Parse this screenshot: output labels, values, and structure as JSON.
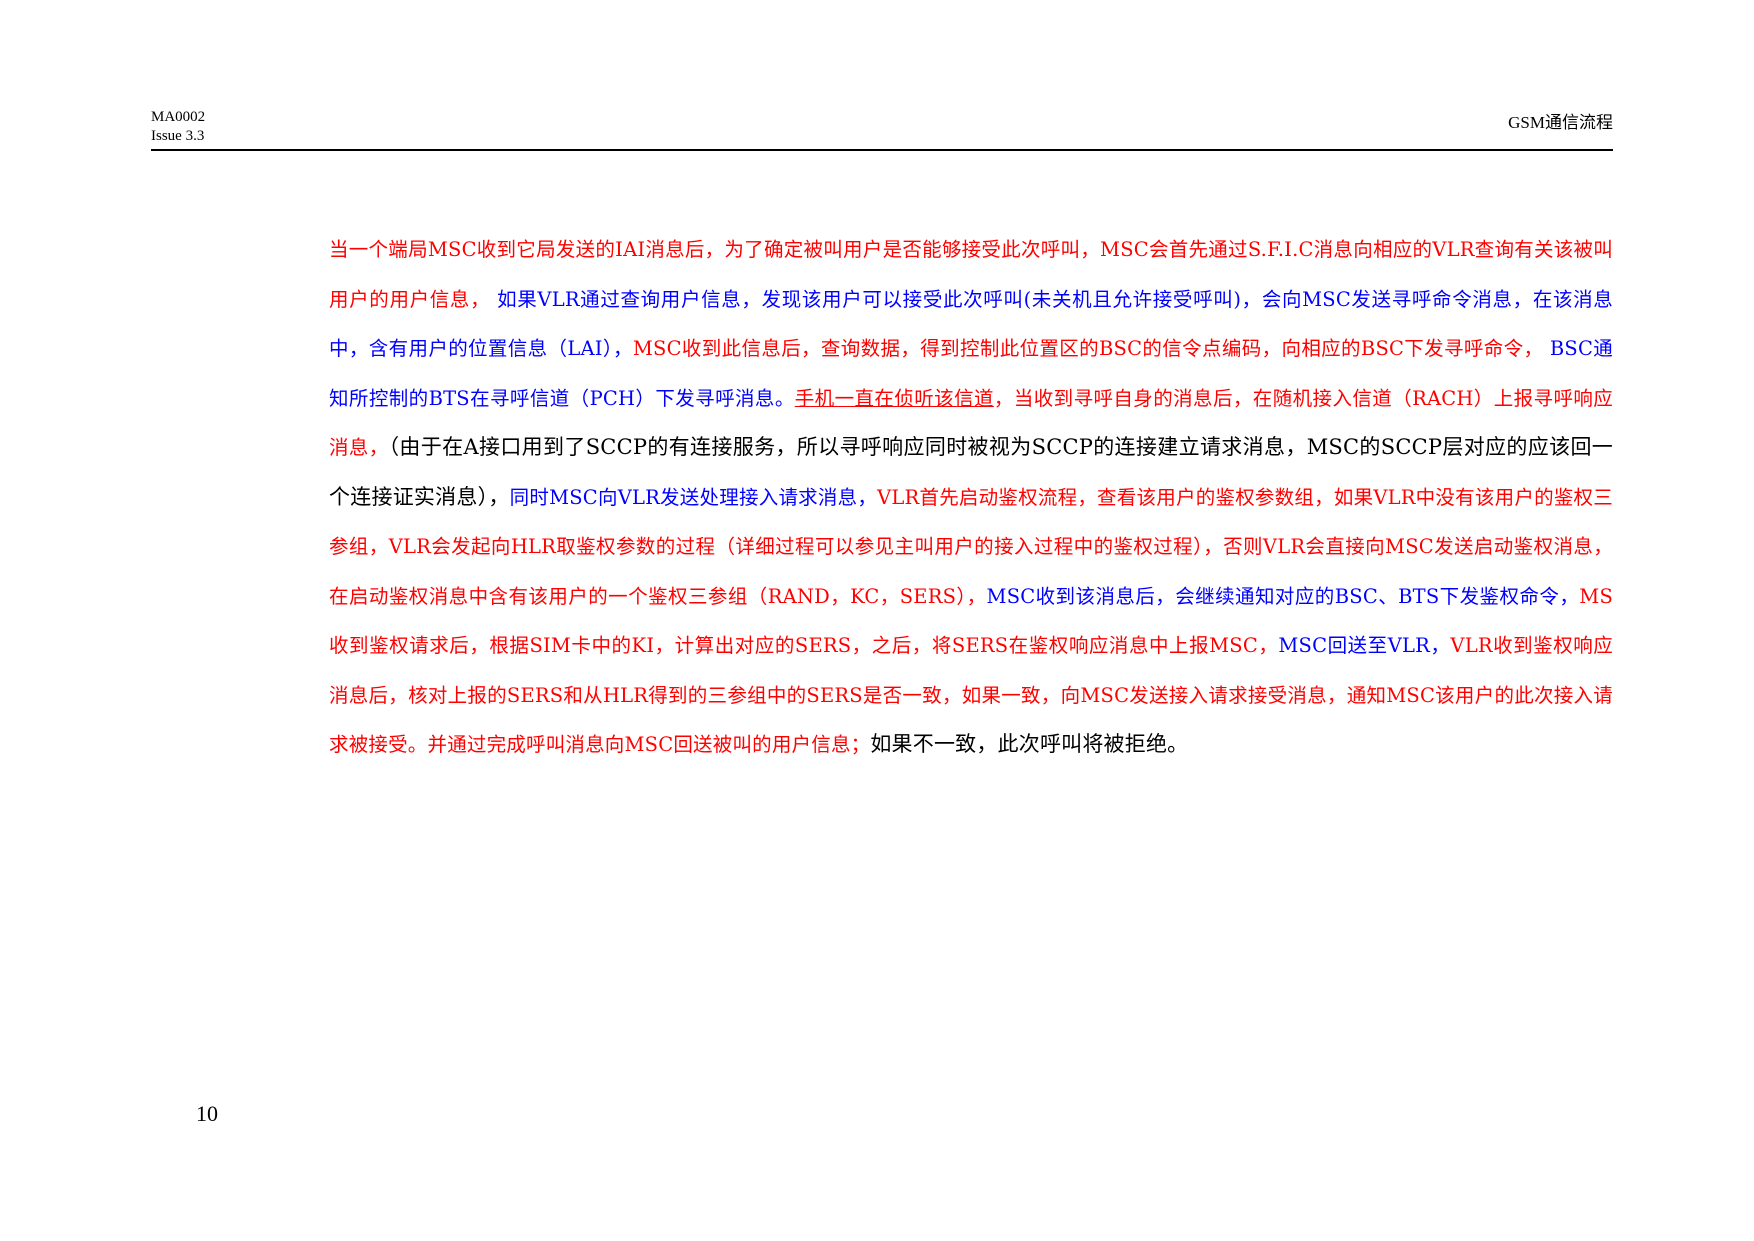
{
  "header": {
    "doc_id": "MA0002",
    "issue": "Issue 3.3",
    "title": "GSM通信流程"
  },
  "colors": {
    "red": "#ff0000",
    "blue": "#0000ff",
    "black": "#000000"
  },
  "paragraph": {
    "s1": "当一个端局MSC收到它局发送的IAI消息后，为了确定被叫用户是否能够接受此次呼叫，MSC会首先通过S.F.I.C消息向相应的VLR查询有关该被叫用户的用户信息，",
    "s2": " 如果VLR通过查询用户信息，发现该用户可以接受此次呼叫(未关机且允许接受呼叫)，会向MSC发送寻呼命令消息，在该消息中，含有用户的位置信息（LAI），",
    "s3": "MSC收到此信息后，查询数据，得到控制此位置区的BSC的信令点编码，向相应的BSC下发寻呼命令，",
    "s4": "  BSC通知所控制的BTS在寻呼信道（PCH）下发寻呼消息。",
    "s5": "手机一直在侦听该信道",
    "s6": "，当收到寻呼自身的消息后，在随机接入信道（RACH）上报寻呼响应消息，",
    "s7": "（由于在A接口用到了SCCP的有连接服务，所以寻呼响应同时被视为SCCP的连接建立请求消息，MSC的SCCP层对应的应该回一个连接证实消息），",
    "s8": "同时MSC向VLR发送处理接入请求消息，",
    "s9": "VLR首先启动鉴权流程，查看该用户的鉴权参数组，如果VLR中没有该用户的鉴权三参组，VLR会发起向HLR取鉴权参数的过程（详细过程可以参见主叫用户的接入过程中的鉴权过程），否则VLR会直接向MSC发送启动鉴权消息，在启动鉴权消息中含有该用户的一个鉴权三参组（RAND，KC，SERS），",
    "s10": "MSC收到该消息后，会继续通知对应的BSC、BTS下发鉴权命令，",
    "s11": "MS收到鉴权请求后，根据SIM卡中的KI，计算出对应的SERS，之后，将SERS在鉴权响应消息中上报MSC，",
    "s12": "MSC回送至VLR，",
    "s13": "VLR收到鉴权响应消息后，核对上报的SERS和从HLR得到的三参组中的SERS是否一致，如果一致，向MSC发送接入请求接受消息，通知MSC该用户的此次接入请求被接受。并通过完成呼叫消息向MSC回送被叫的用户信息；",
    "s14": "如果不一致，此次呼叫将被拒绝。"
  },
  "page_number": "10"
}
